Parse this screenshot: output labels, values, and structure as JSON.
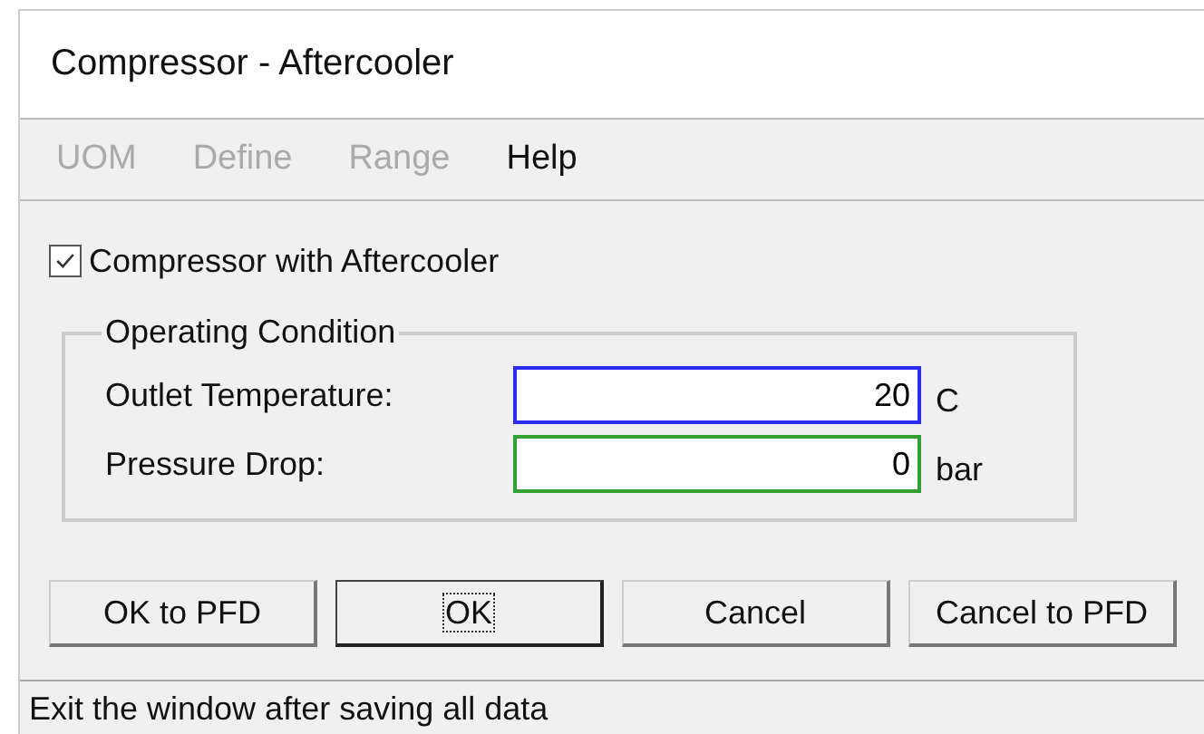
{
  "window": {
    "title": "Compressor - Aftercooler"
  },
  "menu": [
    {
      "label": "UOM",
      "disabled": true
    },
    {
      "label": "Define",
      "disabled": true
    },
    {
      "label": "Range",
      "disabled": true
    },
    {
      "label": "Help",
      "disabled": false
    }
  ],
  "checkbox": {
    "label": "Compressor with Aftercooler",
    "checked": true
  },
  "group": {
    "title": "Operating Condition",
    "fields": [
      {
        "label": "Outlet Temperature:",
        "value": "20",
        "unit": "C",
        "color": "#2a2af0"
      },
      {
        "label": "Pressure Drop:",
        "value": "0",
        "unit": "bar",
        "color": "#30a030"
      }
    ]
  },
  "buttons": [
    {
      "label": "OK to PFD",
      "focused": false
    },
    {
      "label": "OK",
      "focused": true
    },
    {
      "label": "Cancel",
      "focused": false
    },
    {
      "label": "Cancel to PFD",
      "focused": false
    }
  ],
  "status_bar": "Exit the window after saving all data"
}
